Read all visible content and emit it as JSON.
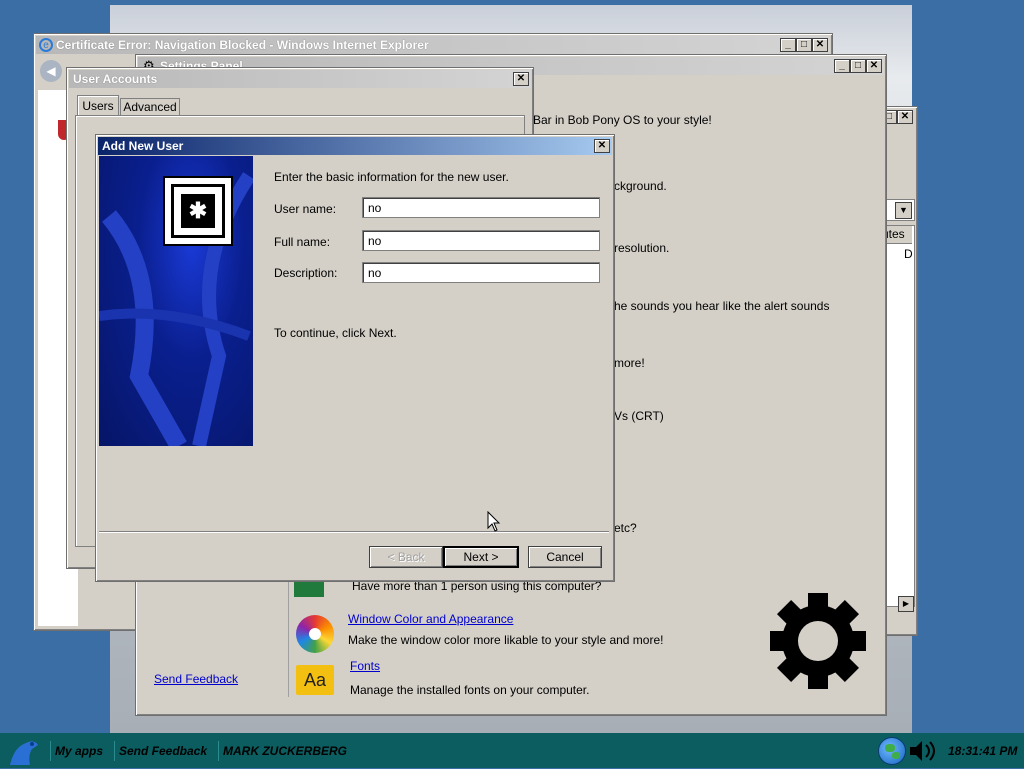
{
  "ie_window": {
    "title": "Certificate Error: Navigation Blocked - Windows Internet Explorer"
  },
  "settings_panel": {
    "title": "Settings Panel",
    "send_feedback": "Send Feedback",
    "items": [
      {
        "text": "Bar in Bob Pony OS to your style!"
      },
      {
        "text": "ckground."
      },
      {
        "text": "resolution."
      },
      {
        "text": "he sounds you hear like the alert sounds"
      },
      {
        "text": "more!"
      },
      {
        "text": "Vs (CRT)"
      },
      {
        "text": "etc?"
      },
      {
        "text": "Have more than 1 person using this computer?"
      }
    ],
    "window_color": {
      "title": "Window Color and Appearance",
      "desc": "Make the window color more likable to your style and more!"
    },
    "fonts": {
      "title": "Fonts",
      "desc": "Manage the installed fonts on your computer."
    }
  },
  "back_window": {
    "header": "utes",
    "cell": "D"
  },
  "user_accounts": {
    "title": "User Accounts",
    "tabs": [
      "Users",
      "Advanced"
    ]
  },
  "add_user": {
    "title": "Add New User",
    "intro": "Enter the basic information for the new user.",
    "fields": [
      {
        "label": "User name:",
        "value": "no"
      },
      {
        "label": "Full name:",
        "value": "no"
      },
      {
        "label": "Description:",
        "value": "no"
      }
    ],
    "continue": "To continue, click Next.",
    "back_label": "< Back",
    "next_label": "Next >",
    "cancel_label": "Cancel"
  },
  "taskbar": {
    "items": [
      "My apps",
      "Send Feedback",
      "MARK ZUCKERBERG"
    ],
    "clock": "18:31:41 PM"
  },
  "colors": {
    "taskbar": "#0b5d60",
    "desktop": "#3a6ea5",
    "wizard_panel": "#0a1f8f",
    "link": "#0000cc"
  }
}
